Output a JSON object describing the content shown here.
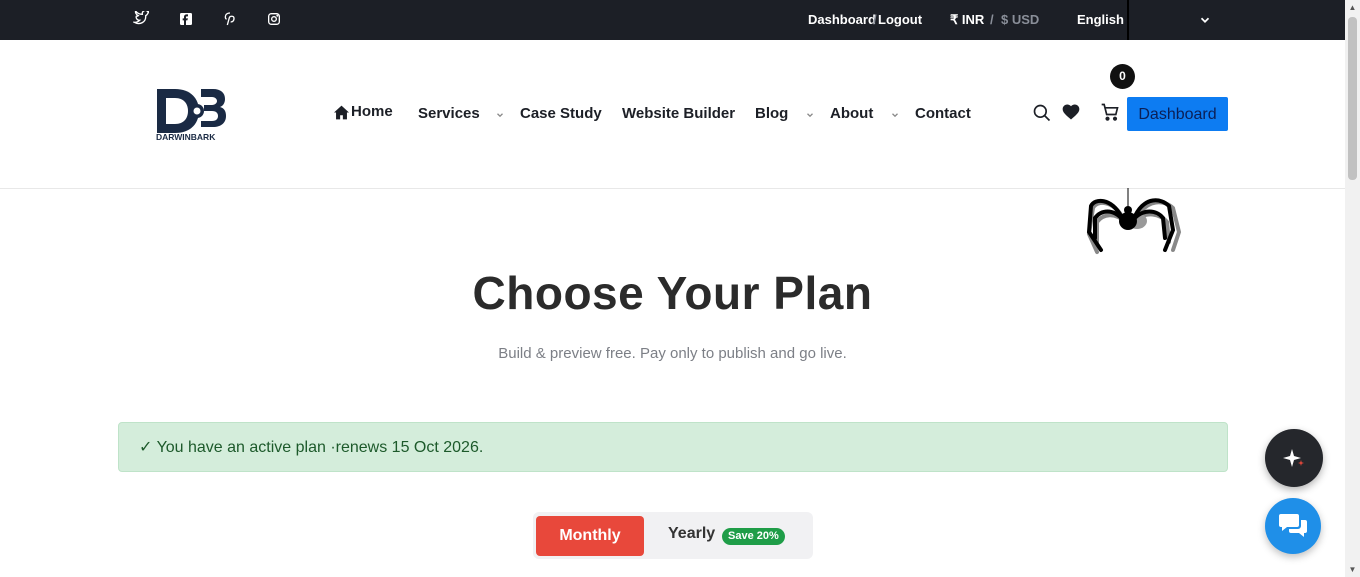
{
  "topbar": {
    "social_icons": [
      "twitter-icon",
      "facebook-icon",
      "pinterest-icon",
      "instagram-icon"
    ],
    "dashboard": "Dashboard",
    "separator": "/",
    "logout": "Logout",
    "currency_inr": "₹ INR",
    "currency_sep": "/",
    "currency_usd": "$ USD",
    "language": "English"
  },
  "header": {
    "logo_text": "DARWINBARK",
    "nav": {
      "home": "Home",
      "services": "Services",
      "case_study": "Case Study",
      "website_builder": "Website Builder",
      "blog": "Blog",
      "about": "About",
      "contact": "Contact"
    },
    "cart_count": "0",
    "dashboard_button": "Dashboard"
  },
  "main": {
    "title": "Choose Your Plan",
    "subtitle": "Build & preview free. Pay only to publish and go live.",
    "alert": "✓ You have an active plan ·renews 15 Oct 2026.",
    "billing_toggle": {
      "monthly": "Monthly",
      "yearly": "Yearly",
      "save_badge": "Save 20%",
      "selected": "Monthly"
    }
  },
  "colors": {
    "topbar_bg": "#1c1f26",
    "accent_red": "#e8483b",
    "accent_blue": "#0d7cf2",
    "success_bg": "#d4eddb",
    "badge_green": "#1f9d48"
  }
}
